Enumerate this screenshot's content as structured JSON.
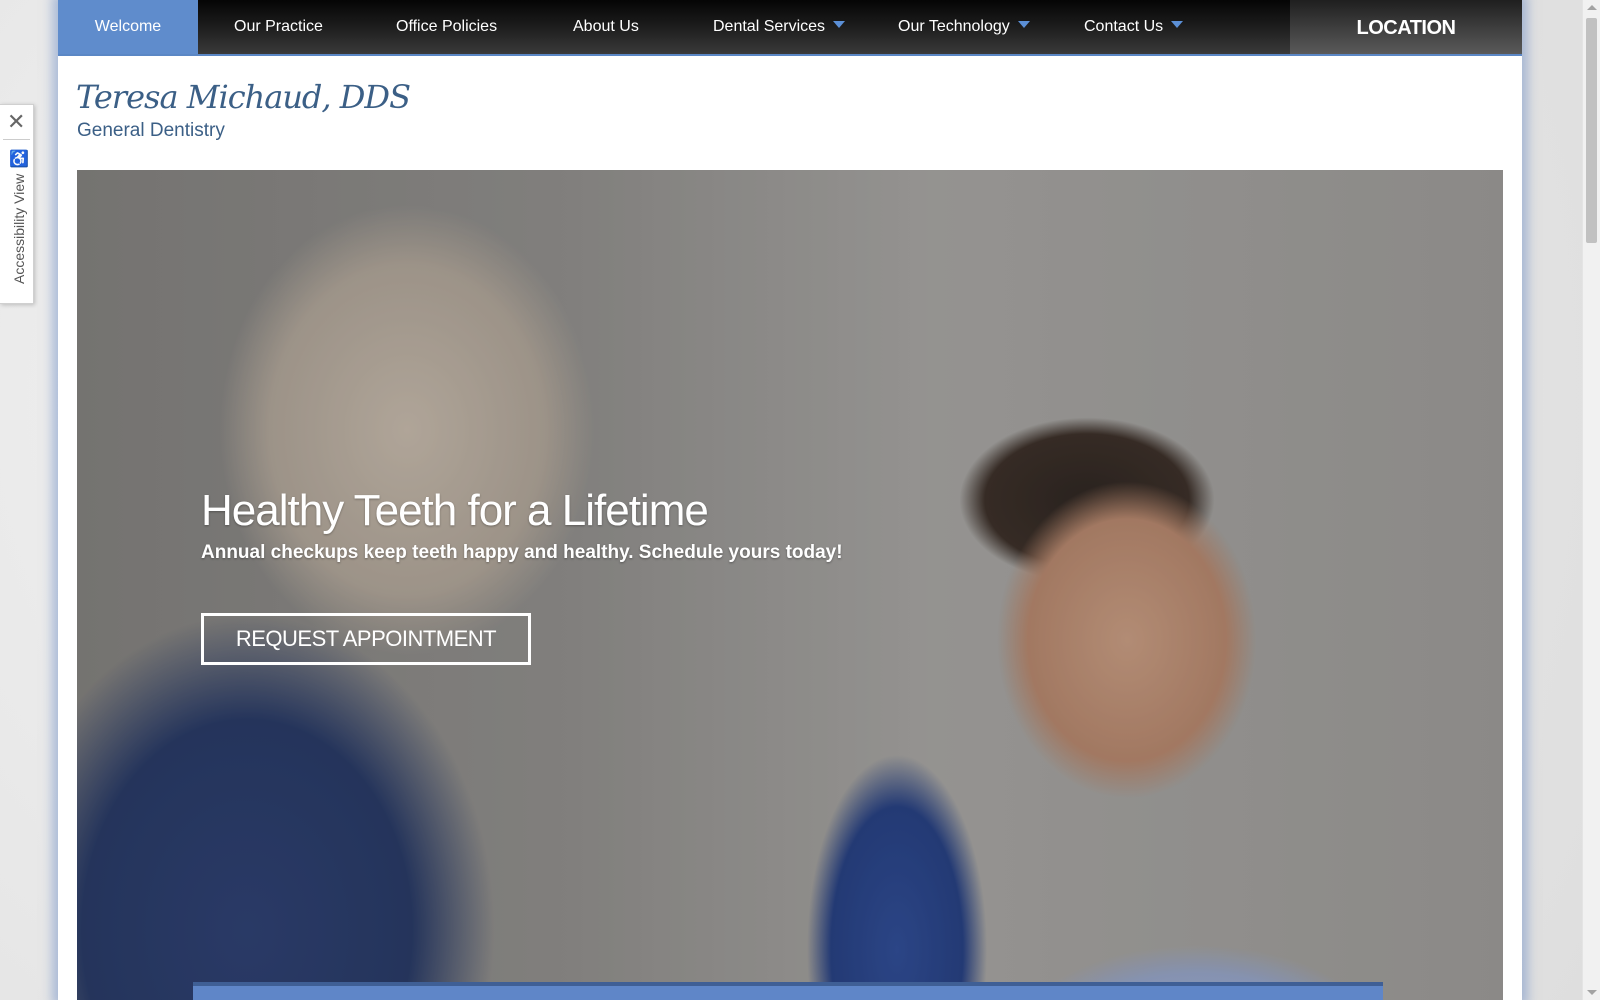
{
  "nav": {
    "items": [
      {
        "label": "Welcome",
        "active": true,
        "dropdown": false
      },
      {
        "label": "Our Practice",
        "active": false,
        "dropdown": false
      },
      {
        "label": "Office Policies",
        "active": false,
        "dropdown": false
      },
      {
        "label": "About Us",
        "active": false,
        "dropdown": false
      },
      {
        "label": "Dental Services",
        "active": false,
        "dropdown": true
      },
      {
        "label": "Our Technology",
        "active": false,
        "dropdown": true
      },
      {
        "label": "Contact Us",
        "active": false,
        "dropdown": true
      }
    ],
    "location_label": "LOCATION"
  },
  "header": {
    "practice_name": "Teresa Michaud, DDS",
    "specialty": "General Dentistry"
  },
  "hero": {
    "title": "Healthy Teeth for a Lifetime",
    "subtitle": "Annual checkups keep teeth happy and healthy. Schedule yours today!",
    "cta_label": "REQUEST APPOINTMENT"
  },
  "accessibility": {
    "close_symbol": "✕",
    "icon": "wheelchair-icon",
    "label": "Accessibility View"
  },
  "colors": {
    "nav_active": "#5f8ccc",
    "brand_text": "#3b5f86",
    "accent_caret": "#5b8fd6"
  }
}
